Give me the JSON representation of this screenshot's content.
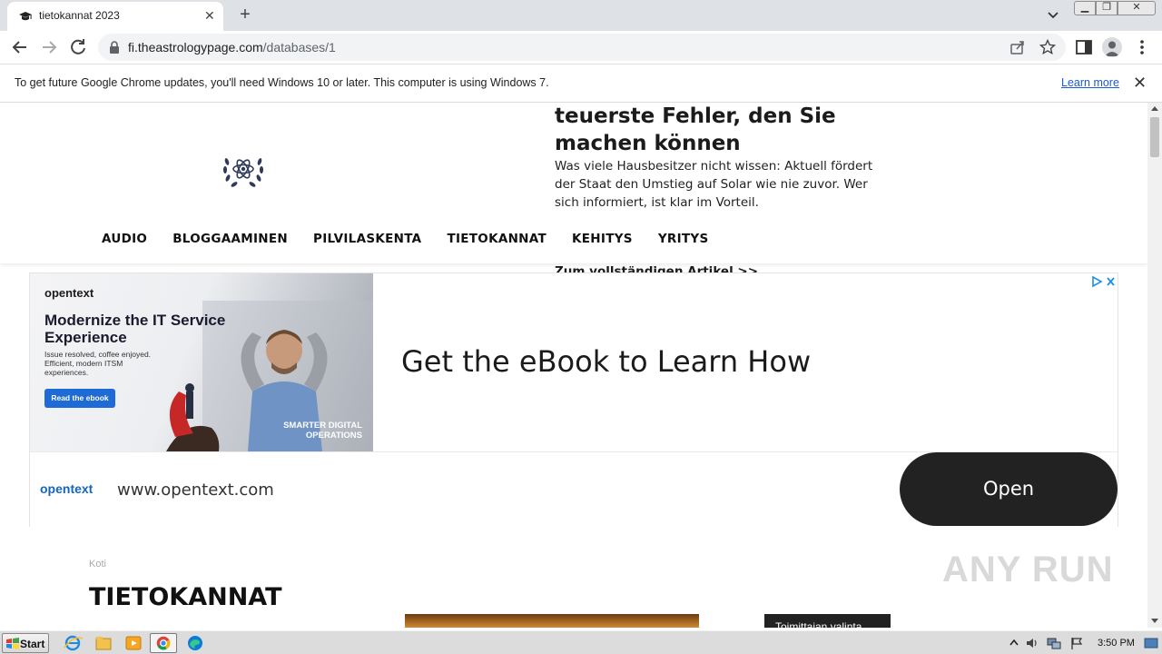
{
  "browser": {
    "tab_title": "tietokannat 2023",
    "url_host": "fi.theastrologypage.com",
    "url_path": "/databases/1",
    "info_bar_text": "To get future Google Chrome updates, you'll need Windows 10 or later. This computer is using Windows 7.",
    "info_bar_link": "Learn more"
  },
  "header_ad": {
    "headline": "teuerste Fehler, den Sie machen können",
    "body": "Was viele Hausbesitzer nicht wissen: Aktuell fördert der Staat den Umstieg auf Solar wie nie zuvor. Wer sich informiert, ist klar im Vorteil.",
    "more_link": "Zum vollständigen Artikel >>"
  },
  "nav": {
    "items": [
      {
        "label": "AUDIO"
      },
      {
        "label": "BLOGGAAMINEN"
      },
      {
        "label": "PILVILASKENTA"
      },
      {
        "label": "TIETOKANNAT"
      },
      {
        "label": "KEHITYS"
      },
      {
        "label": "YRITYS"
      }
    ]
  },
  "banner_ad": {
    "brand": "opentext",
    "image_title": "Modernize the IT Service Experience",
    "image_subtitle": "Issue resolved, coffee enjoyed. Efficient, modern ITSM experiences.",
    "image_cta": "Read the ebook",
    "image_tagline": "SMARTER DIGITAL OPERATIONS",
    "main_text": "Get the eBook to Learn How",
    "footer_url": "www.opentext.com",
    "open_button": "Open",
    "colors": {
      "accent": "#1e6bd6",
      "brand": "#1565c0",
      "button": "#222222"
    }
  },
  "page": {
    "breadcrumb": "Koti",
    "title": "TIETOKANNAT",
    "editor_pick": "Toimittajan valinta",
    "watermark": "ANY RUN"
  },
  "taskbar": {
    "start_label": "Start",
    "clock": "3:50 PM"
  }
}
